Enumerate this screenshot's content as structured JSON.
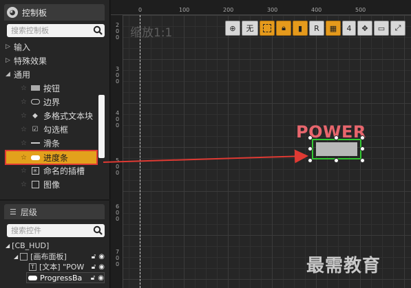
{
  "palette": {
    "title": "控制板",
    "search_placeholder": "搜索控制板",
    "categories": [
      {
        "label": "输入",
        "arrow": "▷"
      },
      {
        "label": "特殊效果",
        "arrow": "▷"
      },
      {
        "label": "通用",
        "arrow": "◢"
      }
    ],
    "items": [
      {
        "label": "按钮"
      },
      {
        "label": "边界"
      },
      {
        "label": "多格式文本块"
      },
      {
        "label": "勾选框"
      },
      {
        "label": "滑条"
      },
      {
        "label": "进度条"
      },
      {
        "label": "命名的插槽"
      },
      {
        "label": "图像"
      }
    ]
  },
  "hierarchy": {
    "title": "层级",
    "search_placeholder": "搜索控件",
    "rows": [
      {
        "label": "[CB_HUD]"
      },
      {
        "label": "[画布面板]"
      },
      {
        "label": "[文本] \"POW"
      },
      {
        "label": "ProgressBa"
      }
    ]
  },
  "canvas": {
    "zoom_label": "缩放1:1",
    "ruler_top": [
      "0",
      "100",
      "200",
      "300",
      "400",
      "500"
    ],
    "ruler_left": [
      "2\n0\n0",
      "3\n0\n0",
      "4\n0\n0",
      "5\n0\n0",
      "6\n0\n0",
      "7\n0\n0"
    ],
    "toolbar": {
      "none_label": "无",
      "r_label": "R",
      "number_label": "4"
    },
    "preview_text": "POWER",
    "watermark": "最需教育"
  },
  "colors": {
    "selection": "#e3a11c",
    "highlight_outline": "#e03a33",
    "power_text": "#e8666d",
    "widget_border": "#32c832"
  }
}
